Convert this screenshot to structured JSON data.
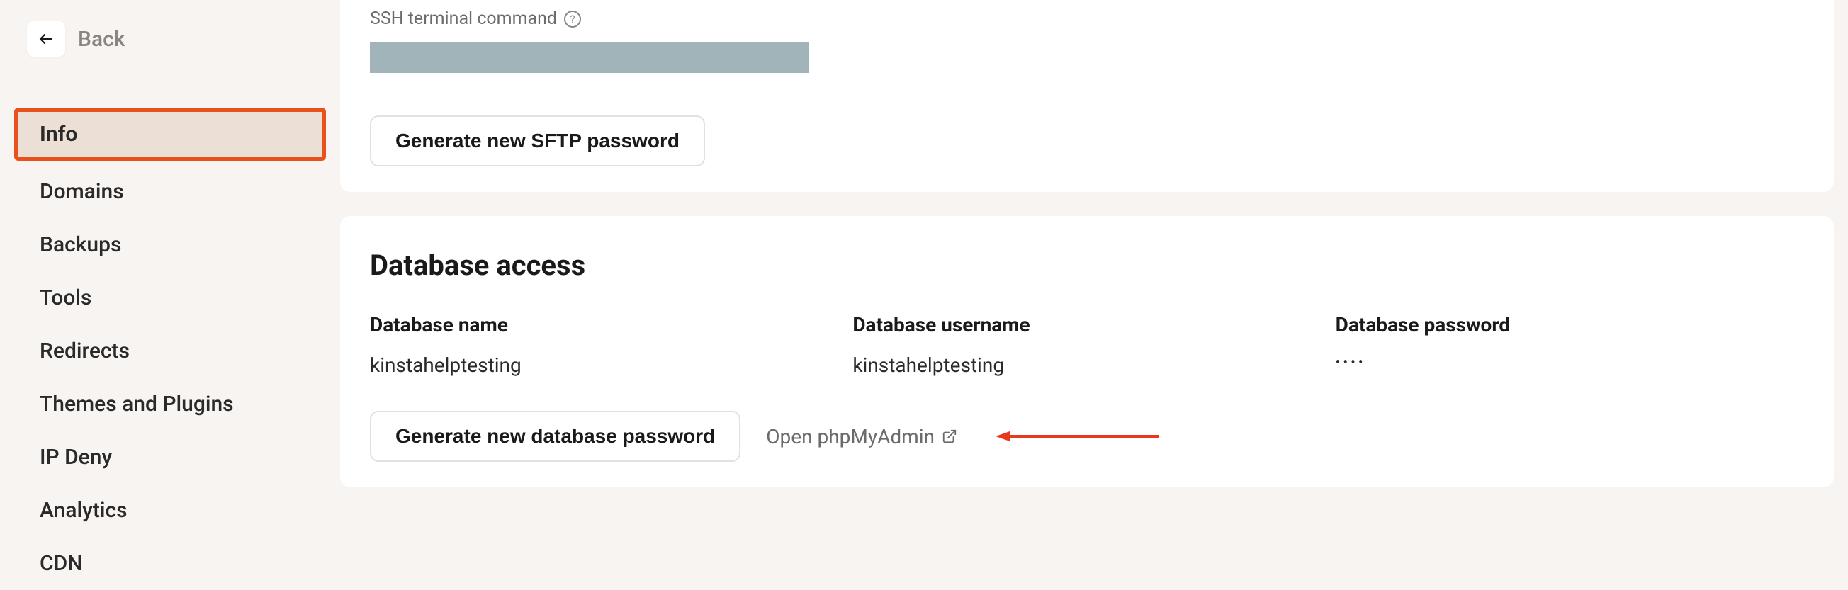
{
  "back": {
    "label": "Back"
  },
  "sidebar": {
    "items": [
      {
        "label": "Info"
      },
      {
        "label": "Domains"
      },
      {
        "label": "Backups"
      },
      {
        "label": "Tools"
      },
      {
        "label": "Redirects"
      },
      {
        "label": "Themes and Plugins"
      },
      {
        "label": "IP Deny"
      },
      {
        "label": "Analytics"
      },
      {
        "label": "CDN"
      }
    ]
  },
  "ssh": {
    "label": "SSH terminal command",
    "button": "Generate new SFTP password"
  },
  "db": {
    "title": "Database access",
    "name_label": "Database name",
    "name_value": "kinstahelptesting",
    "user_label": "Database username",
    "user_value": "kinstahelptesting",
    "pass_label": "Database password",
    "pass_value": "••••",
    "gen_button": "Generate new database password",
    "open_link": "Open phpMyAdmin"
  }
}
